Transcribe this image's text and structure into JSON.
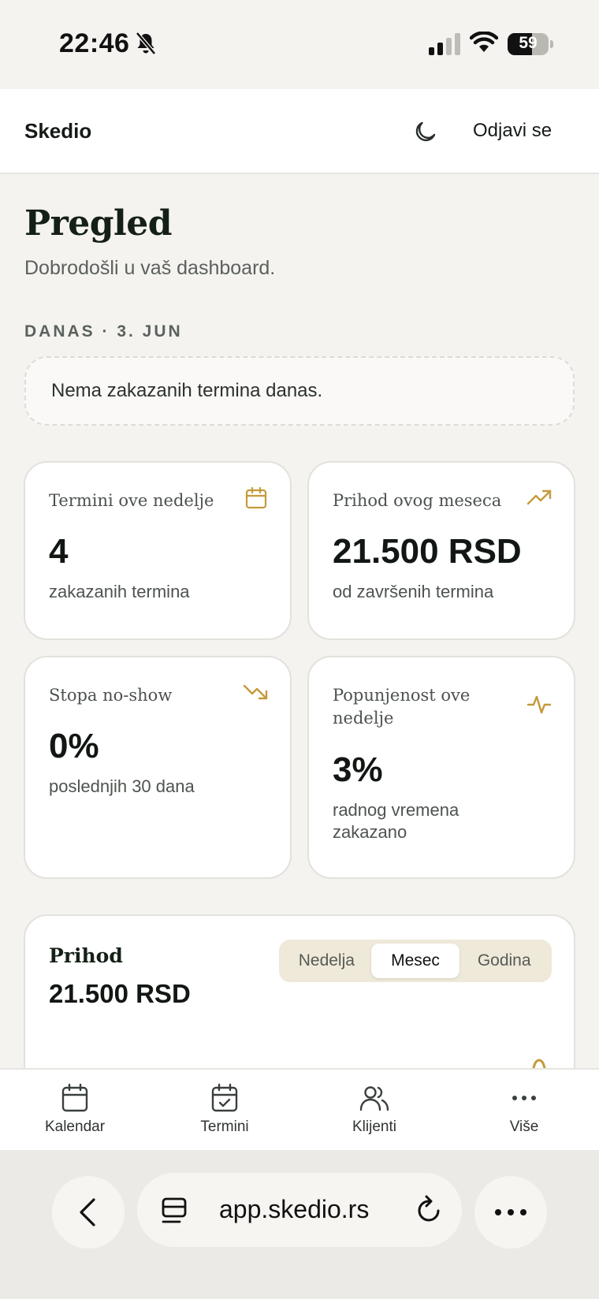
{
  "status_bar": {
    "time": "22:46",
    "battery": "59",
    "battery_level": 0.59
  },
  "header": {
    "brand": "Skedio",
    "logout_label": "Odjavi se"
  },
  "main": {
    "title": "Pregled",
    "subtitle": "Dobrodošli u vaš dashboard.",
    "today_label": "DANAS · 3. JUN",
    "empty_message": "Nema zakazanih termina danas."
  },
  "cards": [
    {
      "title": "Termini ove nedelje",
      "value": "4",
      "sub": "zakazanih termina",
      "icon": "calendar-icon"
    },
    {
      "title": "Prihod ovog meseca",
      "value": "21.500 RSD",
      "sub": "od završenih termina",
      "icon": "trending-up-icon"
    },
    {
      "title": "Stopa no-show",
      "value": "0%",
      "sub": "poslednjih 30 dana",
      "icon": "trending-down-icon"
    },
    {
      "title": "Popunjenost ove nedelje",
      "value": "3%",
      "sub": "radnog vremena zakazano",
      "icon": "activity-icon"
    }
  ],
  "revenue": {
    "title": "Prihod",
    "value": "21.500 RSD",
    "periods": [
      "Nedelja",
      "Mesec",
      "Godina"
    ],
    "active_period": "Mesec"
  },
  "bottom_nav": [
    {
      "label": "Kalendar",
      "icon": "calendar-icon"
    },
    {
      "label": "Termini",
      "icon": "calendar-check-icon"
    },
    {
      "label": "Klijenti",
      "icon": "users-icon"
    },
    {
      "label": "Više",
      "icon": "more-icon"
    }
  ],
  "browser": {
    "url": "app.skedio.rs"
  },
  "colors": {
    "accent": "#c49a3a",
    "segment_bg": "#efe9da",
    "background": "#f4f3f0"
  }
}
